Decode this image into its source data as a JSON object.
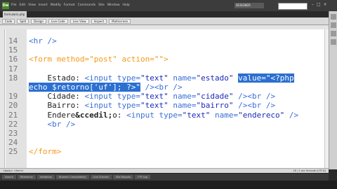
{
  "menubar": {
    "logo": "Dw",
    "items": [
      "File",
      "Edit",
      "View",
      "Insert",
      "Modify",
      "Format",
      "Commands",
      "Site",
      "Window",
      "Help"
    ],
    "workspace": "DESIGNER"
  },
  "document_tab": "formulario.php",
  "toolbar": {
    "buttons": [
      "Code",
      "Split",
      "Design",
      "Live Code",
      "Live View",
      "Inspect",
      "Multiscreen"
    ]
  },
  "editor": {
    "lines": [
      {
        "num": "14",
        "segments": [
          {
            "t": "<hr />",
            "c": "tag"
          }
        ]
      },
      {
        "num": "15",
        "segments": []
      },
      {
        "num": "16",
        "segments": [
          {
            "t": "<form ",
            "c": "orange"
          },
          {
            "t": "method=",
            "c": "orange"
          },
          {
            "t": "\"post\"",
            "c": "orange"
          },
          {
            "t": " action=",
            "c": "orange"
          },
          {
            "t": "\"\">",
            "c": "orange"
          }
        ]
      },
      {
        "num": "17",
        "segments": []
      },
      {
        "num": "18",
        "segments": [
          {
            "t": "    Estado: ",
            "c": "txt"
          },
          {
            "t": "<input ",
            "c": "tag"
          },
          {
            "t": "type=",
            "c": "tag"
          },
          {
            "t": "\"text\"",
            "c": "str"
          },
          {
            "t": " name=",
            "c": "tag"
          },
          {
            "t": "\"estado\"",
            "c": "str"
          },
          {
            "t": " ",
            "c": "txt"
          },
          {
            "t": "value=",
            "c": "sel"
          },
          {
            "t": "\"<?php",
            "c": "sel"
          }
        ]
      },
      {
        "num": "",
        "segments": [
          {
            "t": "echo $retorno['uf']; ?>\"",
            "c": "sel"
          },
          {
            "t": " />",
            "c": "tag"
          },
          {
            "t": "<br />",
            "c": "tag"
          }
        ]
      },
      {
        "num": "19",
        "segments": [
          {
            "t": "    Cidade: ",
            "c": "txt"
          },
          {
            "t": "<input ",
            "c": "tag"
          },
          {
            "t": "type=",
            "c": "tag"
          },
          {
            "t": "\"text\"",
            "c": "str"
          },
          {
            "t": " name=",
            "c": "tag"
          },
          {
            "t": "\"cidade\"",
            "c": "str"
          },
          {
            "t": " />",
            "c": "tag"
          },
          {
            "t": "<br />",
            "c": "tag"
          }
        ]
      },
      {
        "num": "20",
        "segments": [
          {
            "t": "    Bairro: ",
            "c": "txt"
          },
          {
            "t": "<input ",
            "c": "tag"
          },
          {
            "t": "type=",
            "c": "tag"
          },
          {
            "t": "\"text\"",
            "c": "str"
          },
          {
            "t": " name=",
            "c": "tag"
          },
          {
            "t": "\"bairro\"",
            "c": "str"
          },
          {
            "t": " />",
            "c": "tag"
          },
          {
            "t": "<br />",
            "c": "tag"
          }
        ]
      },
      {
        "num": "21",
        "segments": [
          {
            "t": "    Endere",
            "c": "txt"
          },
          {
            "t": "&ccedil;",
            "c": "txtb"
          },
          {
            "t": "o: ",
            "c": "txt"
          },
          {
            "t": "<input ",
            "c": "tag"
          },
          {
            "t": "type=",
            "c": "tag"
          },
          {
            "t": "\"text\"",
            "c": "str"
          },
          {
            "t": " name=",
            "c": "tag"
          },
          {
            "t": "\"endereco\"",
            "c": "str"
          },
          {
            "t": " />",
            "c": "tag"
          }
        ]
      },
      {
        "num": "22",
        "segments": [
          {
            "t": "    <br />",
            "c": "tag"
          }
        ]
      },
      {
        "num": "23",
        "segments": []
      },
      {
        "num": "24",
        "segments": []
      },
      {
        "num": "25",
        "segments": [
          {
            "t": "</form>",
            "c": "orange"
          }
        ]
      }
    ]
  },
  "statusbar": {
    "left": "<body> <form>",
    "right": "1K / 1 sec  Unicode (UTF-8)"
  },
  "panel_tabs": [
    "Search",
    "Reference",
    "Validation",
    "Browser Compatibility",
    "Link Checker",
    "Site Reports",
    "FTP Log"
  ]
}
